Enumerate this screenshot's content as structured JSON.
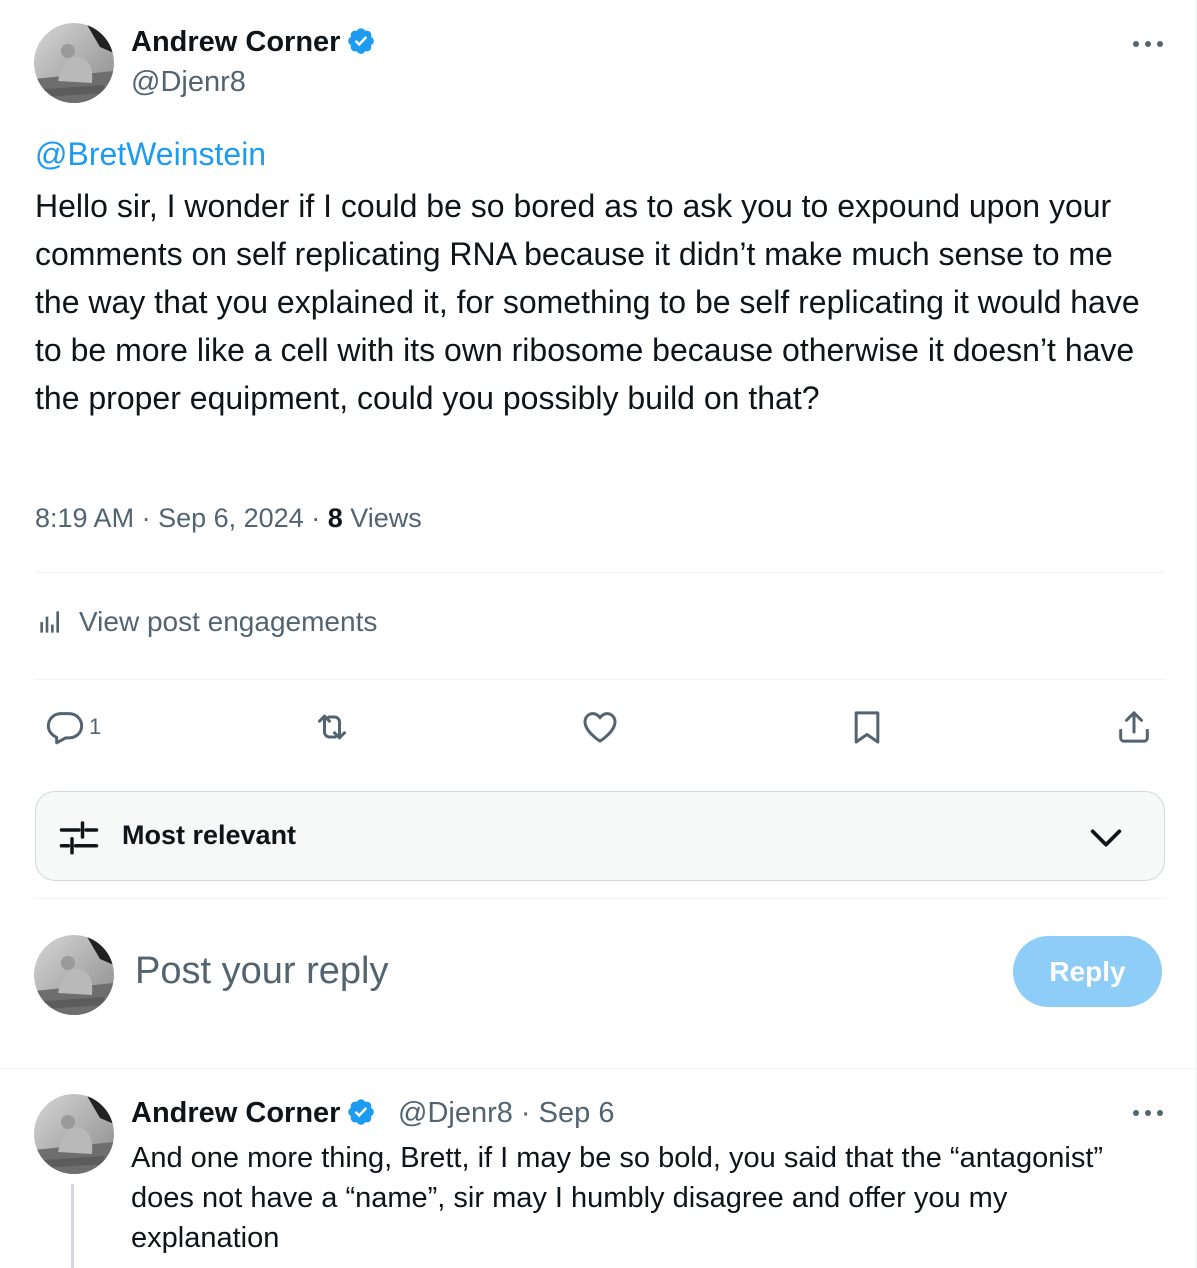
{
  "post": {
    "author_name": "Andrew Corner",
    "author_handle": "@Djenr8",
    "mention": "@BretWeinstein",
    "body": "Hello sir, I wonder if I could be so bored as to ask you to expound upon your comments on self replicating RNA because it didn’t make much sense to me the way that you explained it, for something to be self replicating it would have to be more like a cell with its own ribosome because otherwise it doesn’t have the proper equipment, could you possibly build on that?",
    "time": "8:19 AM",
    "date": "Sep 6, 2024",
    "views_count": "8",
    "views_label": "Views",
    "engagements_label": "View post engagements",
    "reply_count": "1"
  },
  "sort": {
    "label": "Most relevant"
  },
  "composer": {
    "placeholder": "Post your reply",
    "button_label": "Reply"
  },
  "reply": {
    "author_name": "Andrew Corner",
    "author_handle": "@Djenr8",
    "date": "Sep 6",
    "body": "And one more thing, Brett, if I may be so bold, you said that the “antagonist” does not have a “name”, sir may I humbly disagree and offer you my explanation"
  },
  "colors": {
    "accent": "#1d9bf0",
    "secondary_text": "#536471",
    "reply_button_disabled": "#8ecdf8"
  },
  "icons": [
    "verified-badge-icon",
    "more-options-icon",
    "analytics-icon",
    "reply-icon",
    "repost-icon",
    "like-icon",
    "bookmark-icon",
    "share-icon",
    "sort-sliders-icon",
    "chevron-down-icon"
  ]
}
